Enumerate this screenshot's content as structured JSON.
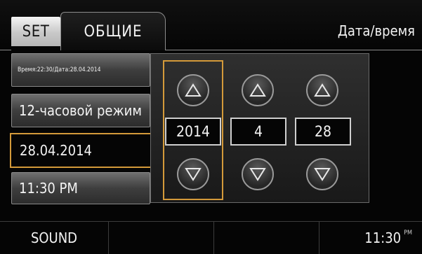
{
  "tabs": {
    "set_label": "SET",
    "general_label": "ОБЩИЕ"
  },
  "header": {
    "title": "Дата/время"
  },
  "menu": {
    "time_date_summary": "Время:22:30/Дата:28.04.2014",
    "hour_mode": "12-часовой режим",
    "date_value": "28.04.2014",
    "time_value": "11:30 PM"
  },
  "picker": {
    "year": "2014",
    "month": "4",
    "day": "28",
    "up_icon": "triangle-up-icon",
    "down_icon": "triangle-down-icon"
  },
  "bottom": {
    "sound_label": "SOUND",
    "clock_time": "11:30",
    "clock_ampm": "PM"
  },
  "colors": {
    "accent": "#d49a3a",
    "background": "#050505"
  }
}
